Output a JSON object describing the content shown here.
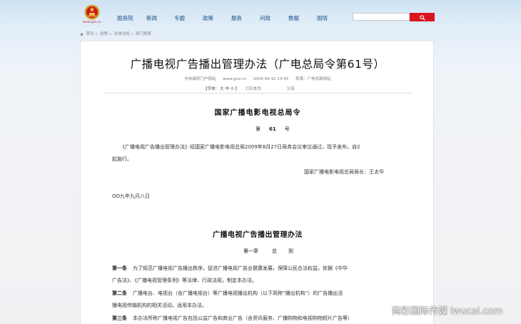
{
  "header": {
    "site_url": "www.gov.cn",
    "nav": [
      {
        "label": "国务院"
      },
      {
        "label": "新闻"
      },
      {
        "label": "专题"
      },
      {
        "label": "政策"
      },
      {
        "label": "服务"
      },
      {
        "label": "问政"
      },
      {
        "label": "数据"
      },
      {
        "label": "国情"
      }
    ],
    "search": {
      "placeholder": "",
      "button_icon": "search-icon"
    }
  },
  "breadcrumb": [
    "首页",
    "政策",
    "法律法规",
    "部门规章"
  ],
  "article": {
    "title": "广播电视广告播出管理办法（广电总局令第61号）",
    "meta": {
      "source_site": "中央政府门户网站",
      "url": "www.gov.cn",
      "datetime": "2009-09-10 13:45",
      "source": "来源：广电总局网站"
    },
    "tools": {
      "font_label": "【字体：",
      "font_sizes": [
        "大",
        "中",
        "小"
      ],
      "font_end": "】",
      "print": "打印本页",
      "share": "分享"
    },
    "issuer": "国家广播电影电视总局令",
    "order": {
      "prefix": "第",
      "number": "61",
      "suffix": "号"
    },
    "intro_line1": "《广播电视广告播出管理办法》经国家广播电影电视总局2009年8月27日局务会议审议通过，现予发布，自2",
    "intro_line2": "起施行。",
    "signature": "国家广播电影电视总局局长：王太华",
    "date": "OO九年九月八日",
    "law_title": "广播电视广告播出管理办法",
    "chapter": {
      "num": "第一章",
      "t1": "总",
      "t2": "则"
    },
    "articles": [
      {
        "label": "第一条",
        "line1": "为了规范广播电视广告播出秩序，促进广播电视广告业健康发展，保障公民合法权益，依据《中华",
        "line2": "广告法》、《广播电视管理条例》等法律、行政法规，制定本办法。"
      },
      {
        "label": "第二条",
        "line1": "广播电台、电视台（含广播电视台）等广播电视播出机构（以下简称“播出机构”）的广告播出活",
        "line2": "播电视传输机构的相关活动，适用本办法。"
      },
      {
        "label": "第三条",
        "line1": "本办法所称广播电视广告包括公益广告和商业广告（含资讯服务、广播购物和电视购物短片广告等）",
        "line2": ""
      }
    ]
  },
  "watermark": "舞彩国际传媒 iwucai.com",
  "colors": {
    "nav_text": "#1b4e86",
    "search_button": "#d9161c",
    "title_text": "#111111"
  }
}
